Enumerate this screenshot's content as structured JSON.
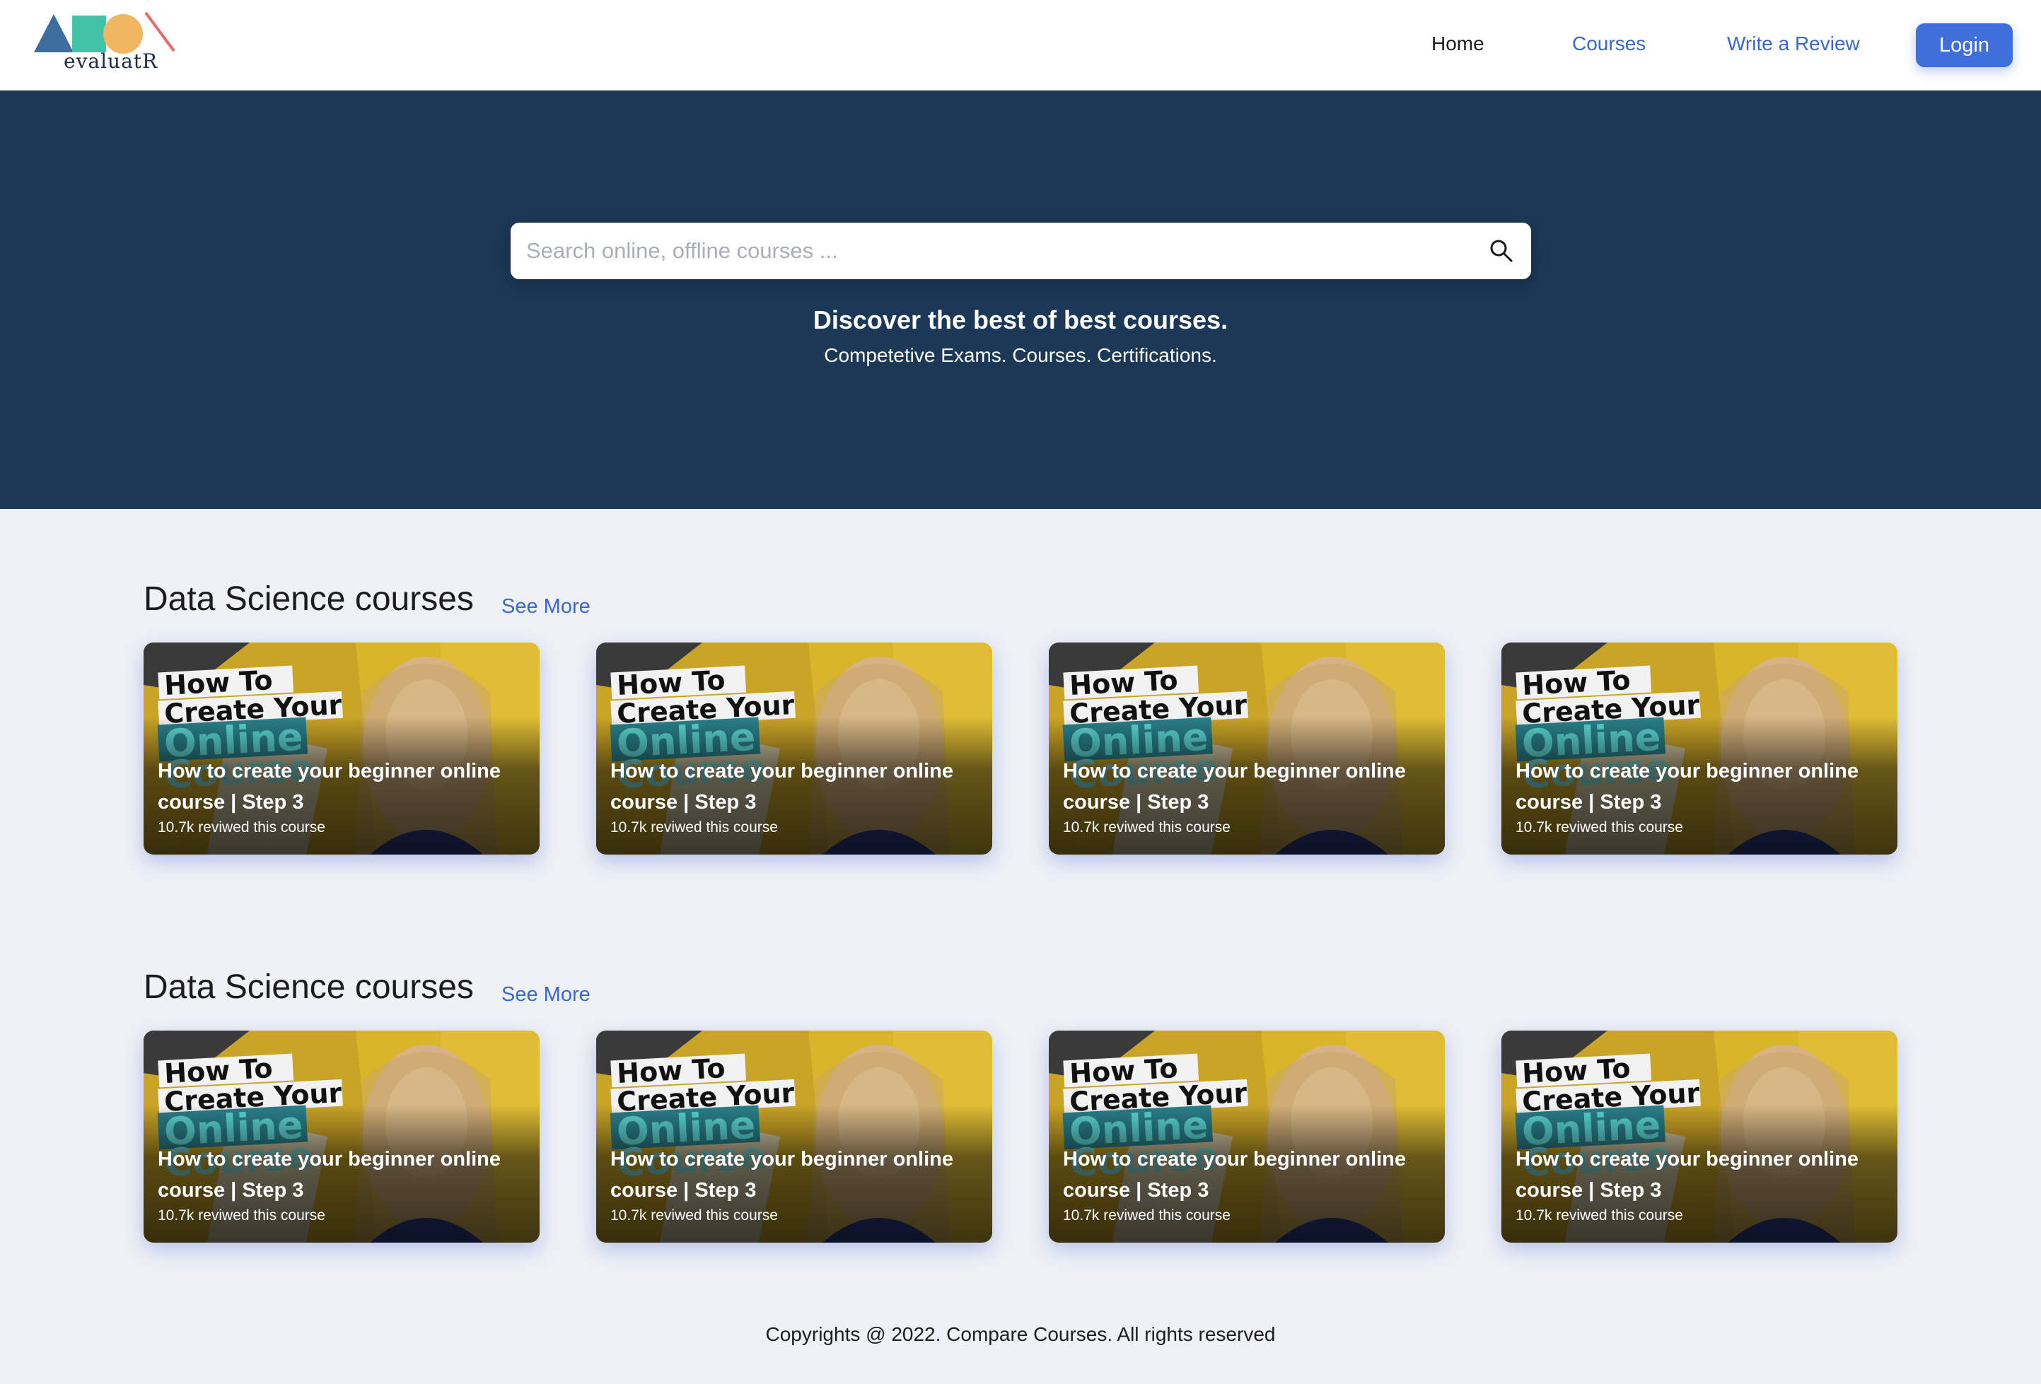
{
  "brand": {
    "name": "evaluatR"
  },
  "nav": {
    "home": "Home",
    "courses": "Courses",
    "review": "Write a Review",
    "login": "Login"
  },
  "hero": {
    "search_placeholder": "Search online, offline courses ...",
    "title": "Discover the best of best courses.",
    "subtitle": "Competetive Exams. Courses. Certifications."
  },
  "sections": [
    {
      "title": "Data Science courses",
      "see_more": "See More",
      "cards": [
        {
          "title": "How to create your beginner online course | Step 3",
          "count": "10.7k reviwed this course"
        },
        {
          "title": "How to create your beginner online course | Step 3",
          "count": "10.7k reviwed this course"
        },
        {
          "title": "How to create your beginner online course | Step 3",
          "count": "10.7k reviwed this course"
        },
        {
          "title": "How to create your beginner online course | Step 3",
          "count": "10.7k reviwed this course"
        }
      ]
    },
    {
      "title": "Data Science courses",
      "see_more": "See More",
      "cards": [
        {
          "title": "How to create your beginner online course | Step 3",
          "count": "10.7k reviwed this course"
        },
        {
          "title": "How to create your beginner online course | Step 3",
          "count": "10.7k reviwed this course"
        },
        {
          "title": "How to create your beginner online course | Step 3",
          "count": "10.7k reviwed this course"
        },
        {
          "title": "How to create your beginner online course | Step 3",
          "count": "10.7k reviwed this course"
        }
      ]
    }
  ],
  "thumbnail": {
    "line1": "How To",
    "line2": "Create Your",
    "line3": "Online",
    "line4": "Course"
  },
  "footer": {
    "text": "Copyrights @ 2022. Compare Courses. All rights reserved"
  },
  "colors": {
    "hero_bg": "#1c3857",
    "accent": "#3f6fd8",
    "link": "#3a67cf",
    "page_bg": "#eff1f6"
  }
}
